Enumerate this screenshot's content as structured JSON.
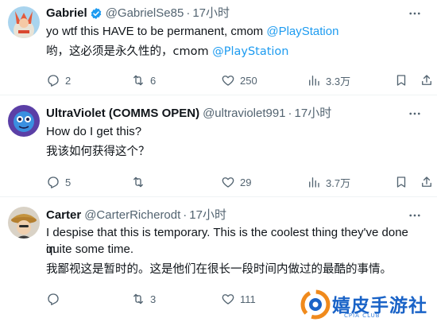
{
  "colors": {
    "accent": "#1d9bf0",
    "muted": "#536471",
    "text": "#0f1419",
    "divider": "#eff3f4"
  },
  "tweets": [
    {
      "name": "Gabriel",
      "verified": true,
      "handle": "@GabrielSe85",
      "separator": "·",
      "time": "17小时",
      "text_prefix": "yo wtf this HAVE to be permanent, cmom ",
      "text_mention": "@PlayStation",
      "translation_prefix": "哟，这必须是永久性的，cmom ",
      "translation_mention": "@PlayStation",
      "replies": "2",
      "retweets": "6",
      "likes": "250",
      "views": "3.3万"
    },
    {
      "name": "UltraViolet (COMMS OPEN)",
      "handle": "@ultraviolet991",
      "separator": "·",
      "time": "17小时",
      "text": "How do I get this?",
      "translation": "我该如何获得这个？",
      "replies": "5",
      "retweets": "",
      "likes": "29",
      "views": "3.7万"
    },
    {
      "name": "Carter",
      "handle": "@CarterRicherodt",
      "separator": "·",
      "time": "17小时",
      "text_line1": "I despise that this is temporary. This is the coolest thing they've done in",
      "text_line2": "quite some time.",
      "translation": "我鄙视这是暂时的。这是他们在很长一段时间内做过的最酷的事情。",
      "replies": "",
      "retweets": "3",
      "likes": "111",
      "views": ""
    }
  ],
  "watermark": {
    "text": "嬉皮手游社",
    "sub": "CPIA CLUB"
  }
}
